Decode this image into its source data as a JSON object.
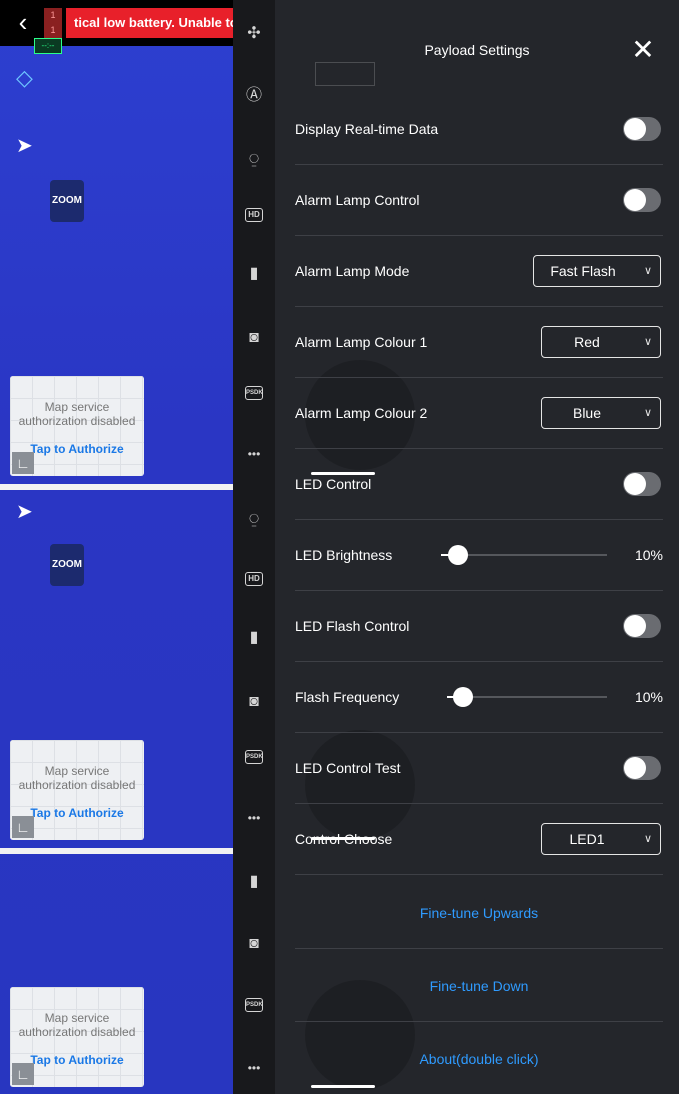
{
  "status_bar": {
    "back_icon": "chevron-left-icon",
    "rc_indicator": "1\n1",
    "alert": "tical low battery. Unable to take o",
    "signal": "--:--"
  },
  "left_view": {
    "zoom_label": "ZOOM",
    "map_cards": [
      {
        "message": "Map service authorization disabled",
        "action": "Tap to Authorize"
      },
      {
        "message": "Map service authorization disabled",
        "action": "Tap to Authorize"
      },
      {
        "message": "Map service authorization disabled",
        "action": "Tap to Authorize"
      }
    ]
  },
  "tool_column": {
    "items": [
      "drone-icon",
      "joystick-icon",
      "remote-controller-icon",
      "hd-icon",
      "battery-icon",
      "camera-icon",
      "psdk-icon",
      "more-icon"
    ],
    "hd_label": "HD",
    "psdk_label": "PSDK",
    "more_label": "•••"
  },
  "panel": {
    "title": "Payload Settings",
    "close_icon": "close-icon",
    "rows": {
      "display_realtime": "Display Real-time Data",
      "alarm_lamp_control": "Alarm Lamp Control",
      "alarm_lamp_mode": "Alarm Lamp Mode",
      "alarm_lamp_mode_value": "Fast Flash",
      "alarm_lamp_colour1": "Alarm Lamp Colour 1",
      "alarm_lamp_colour1_value": "Red",
      "alarm_lamp_colour2": "Alarm Lamp Colour 2",
      "alarm_lamp_colour2_value": "Blue",
      "led_control": "LED Control",
      "led_brightness": "LED Brightness",
      "led_brightness_value": "10%",
      "led_flash_control": "LED Flash Control",
      "flash_frequency": "Flash Frequency",
      "flash_frequency_value": "10%",
      "led_control_test": "LED Control Test",
      "control_choose": "Control Choose",
      "control_choose_value": "LED1"
    },
    "toggles": {
      "display_realtime": false,
      "alarm_lamp_control": false,
      "led_control": false,
      "led_flash_control": false,
      "led_control_test": false
    },
    "sliders": {
      "led_brightness": 0.1,
      "flash_frequency": 0.1
    },
    "actions": {
      "fine_tune_up": "Fine-tune Upwards",
      "fine_tune_down": "Fine-tune Down",
      "about": "About(double click)"
    },
    "chevron_icon": "chevron-down-icon"
  },
  "colors": {
    "panel_bg": "#24262b",
    "accent_link": "#2f9bff",
    "alert_red": "#e8202a",
    "camera_blue": "#2d3fd0"
  }
}
